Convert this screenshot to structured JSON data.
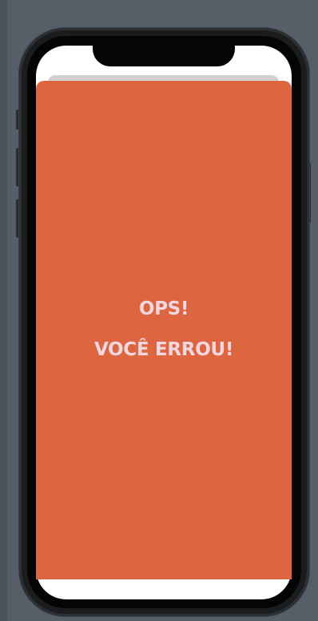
{
  "screen": {
    "title_line_1": "OPS!",
    "title_line_2": "VOCÊ ERROU!"
  },
  "colors": {
    "card_background": "#dd6640",
    "message_text": "#f1d8e0",
    "screen_background": "#ffffff",
    "simulator_background": "#565e67"
  }
}
